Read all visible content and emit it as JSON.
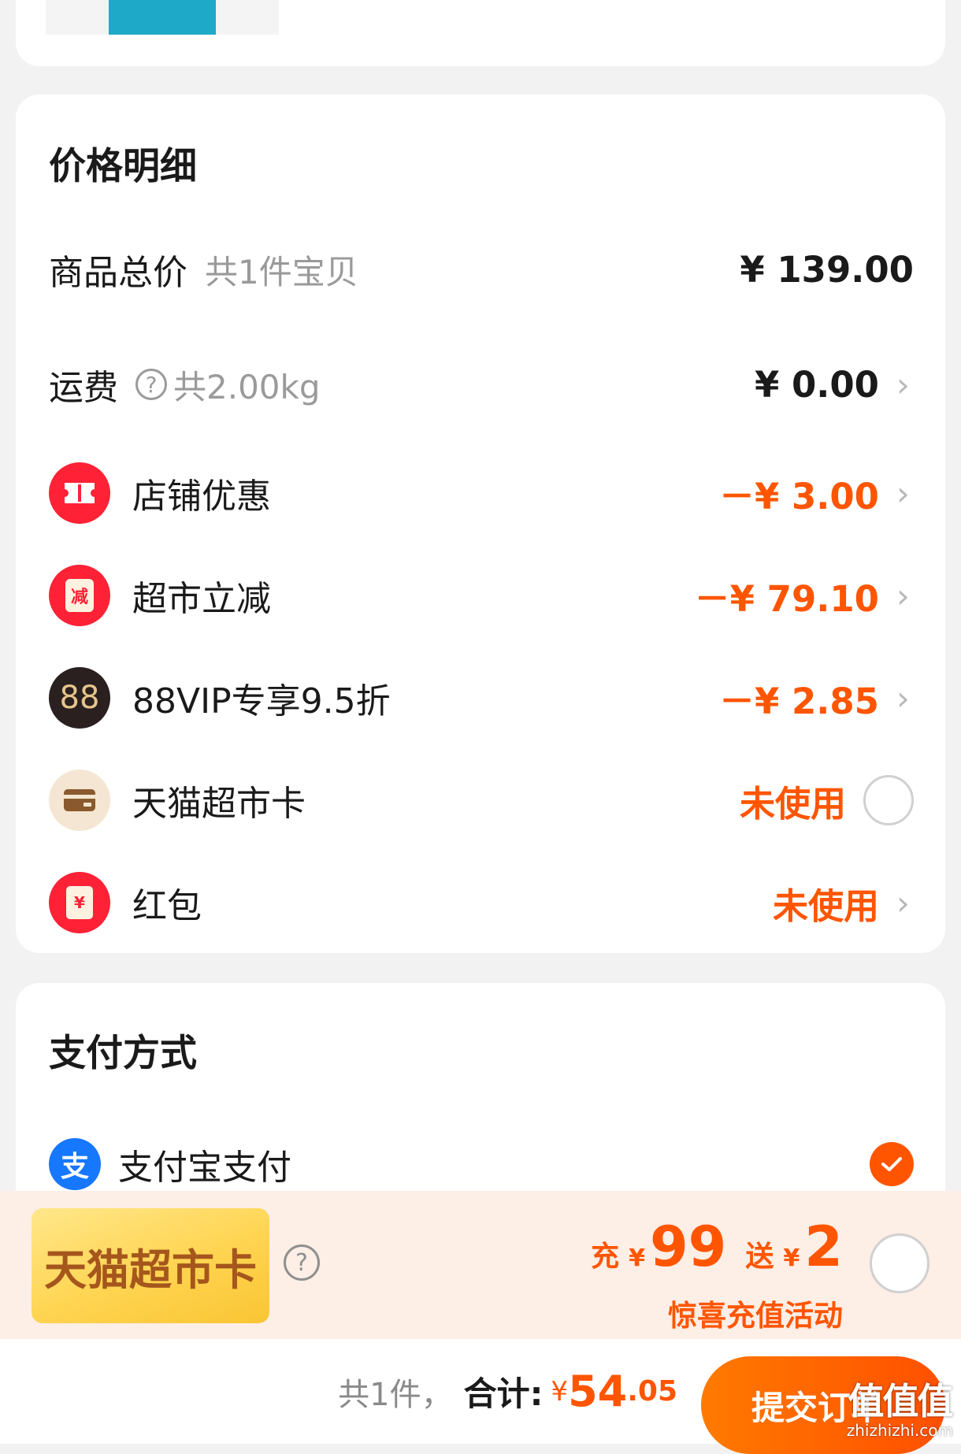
{
  "price_detail": {
    "title": "价格明细",
    "subtotal": {
      "label": "商品总价",
      "sub": "共1件宝贝",
      "amount": "¥ 139.00"
    },
    "shipping": {
      "label": "运费",
      "help": "?",
      "sub": "共2.00kg",
      "amount": "¥ 0.00",
      "chevron": "›"
    },
    "discounts": [
      {
        "icon": "ticket-icon",
        "label": "店铺优惠",
        "amount": "－¥ 3.00",
        "chevron": "›"
      },
      {
        "icon": "jar-icon",
        "icon_text": "减",
        "label": "超市立减",
        "amount": "－¥ 79.10",
        "chevron": "›"
      },
      {
        "icon": "vip88-icon",
        "icon_text": "88",
        "label": "88VIP专享9.5折",
        "amount": "－¥ 2.85",
        "chevron": "›"
      }
    ],
    "tmall_card": {
      "icon": "card-icon",
      "label": "天猫超市卡",
      "status": "未使用"
    },
    "red_packet": {
      "icon": "red-packet-icon",
      "icon_text": "¥",
      "label": "红包",
      "status": "未使用",
      "chevron": "›"
    }
  },
  "payment": {
    "title": "支付方式",
    "method": {
      "icon": "alipay-icon",
      "icon_text": "支",
      "label": "支付宝支付",
      "selected": true
    }
  },
  "promo": {
    "card_label": "天猫超市卡",
    "help": "?",
    "charge_label": "充",
    "charge_yen": "¥",
    "charge_amount": "99",
    "bonus_label": "送",
    "bonus_yen": "¥",
    "bonus_amount": "2",
    "description": "惊喜充值活动"
  },
  "footer": {
    "count": "共1件，",
    "total_label": "合计:",
    "yen": "¥",
    "total_int": "54",
    "total_dec": ".05",
    "submit_label": "提交订单"
  },
  "watermark": {
    "logo": "值值值",
    "domain": "zhizhizhi.com"
  },
  "colors": {
    "accent": "#ff5500",
    "badge_red": "#ff2236",
    "alipay_blue": "#1677ff",
    "vip_dark": "#2b2020"
  }
}
